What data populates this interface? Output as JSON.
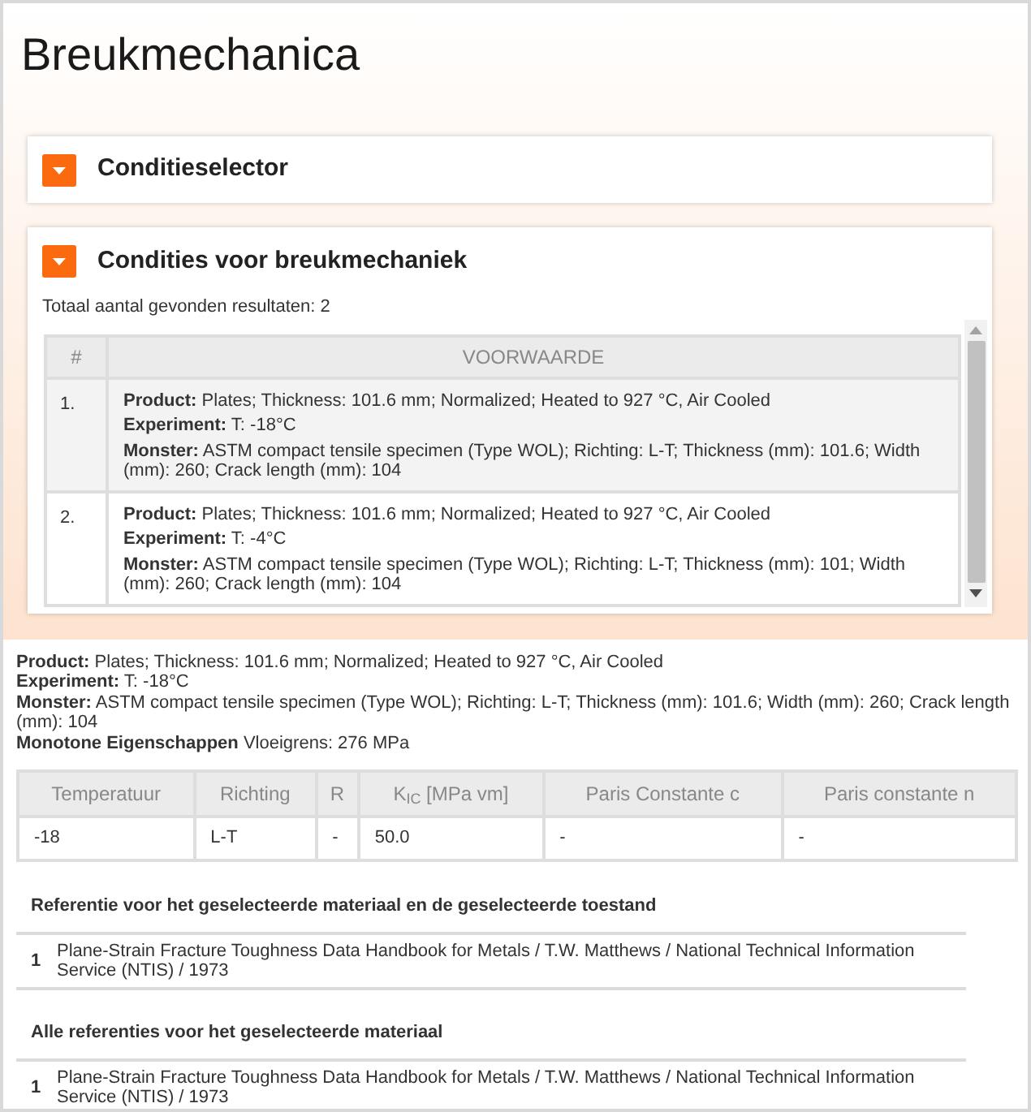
{
  "page": {
    "title": "Breukmechanica"
  },
  "condition_selector": {
    "title": "Conditieselector"
  },
  "conditions": {
    "title": "Condities voor breukmechaniek",
    "result_count": "Totaal aantal gevonden resultaten: 2",
    "table": {
      "columns": [
        "#",
        "VOORWAARDE"
      ],
      "rows": [
        {
          "number": "1.",
          "selected": true,
          "lines": [
            "**Product:** Plates; Thickness: 101.6 mm; Normalized; Heated to 927 °C, Air Cooled",
            "**Experiment:** T: -18°C",
            "**Monster:** ASTM compact tensile specimen (Type WOL); Richting: L-T; Thickness (mm): 101.6; Width (mm): 260; Crack length (mm): 104"
          ]
        },
        {
          "number": "2.",
          "selected": false,
          "lines": [
            "**Product:** Plates; Thickness: 101.6 mm; Normalized; Heated to 927 °C, Air Cooled",
            "**Experiment:** T: -4°C",
            "**Monster:** ASTM compact tensile specimen (Type WOL); Richting: L-T; Thickness (mm): 101; Width (mm): 260; Crack length (mm): 104"
          ]
        }
      ]
    }
  },
  "details": {
    "lines": [
      "**Product:** Plates; Thickness: 101.6 mm; Normalized; Heated to 927 °C, Air Cooled",
      "**Experiment:** T: -18°C",
      "**Monster:** ASTM compact tensile specimen (Type WOL); Richting: L-T; Thickness (mm): 101.6; Width (mm): 260; Crack length (mm): 104",
      "**Monotone Eigenschappen** Vloeigrens: 276 MPa"
    ]
  },
  "results_table": {
    "columns": [
      "Temperatuur",
      "Richting",
      "R",
      "K$_{IC}$ [MPa vm]",
      "Paris Constante c",
      "Paris constante n"
    ],
    "rows": [
      [
        "-18",
        "L-T",
        "-",
        "50.0",
        "-",
        "-"
      ]
    ]
  },
  "references": [
    {
      "heading": "Referentie voor het geselecteerde materiaal en de geselecteerde toestand",
      "items": [
        {
          "number": "1",
          "text": "Plane-Strain Fracture Toughness Data Handbook for Metals / T.W. Matthews / National Technical Information Service (NTIS) / 1973"
        }
      ]
    },
    {
      "heading": "Alle referenties voor het geselecteerde materiaal",
      "items": [
        {
          "number": "1",
          "text": "Plane-Strain Fracture Toughness Data Handbook for Metals / T.W. Matthews / National Technical Information Service (NTIS) / 1973"
        }
      ]
    }
  ]
}
